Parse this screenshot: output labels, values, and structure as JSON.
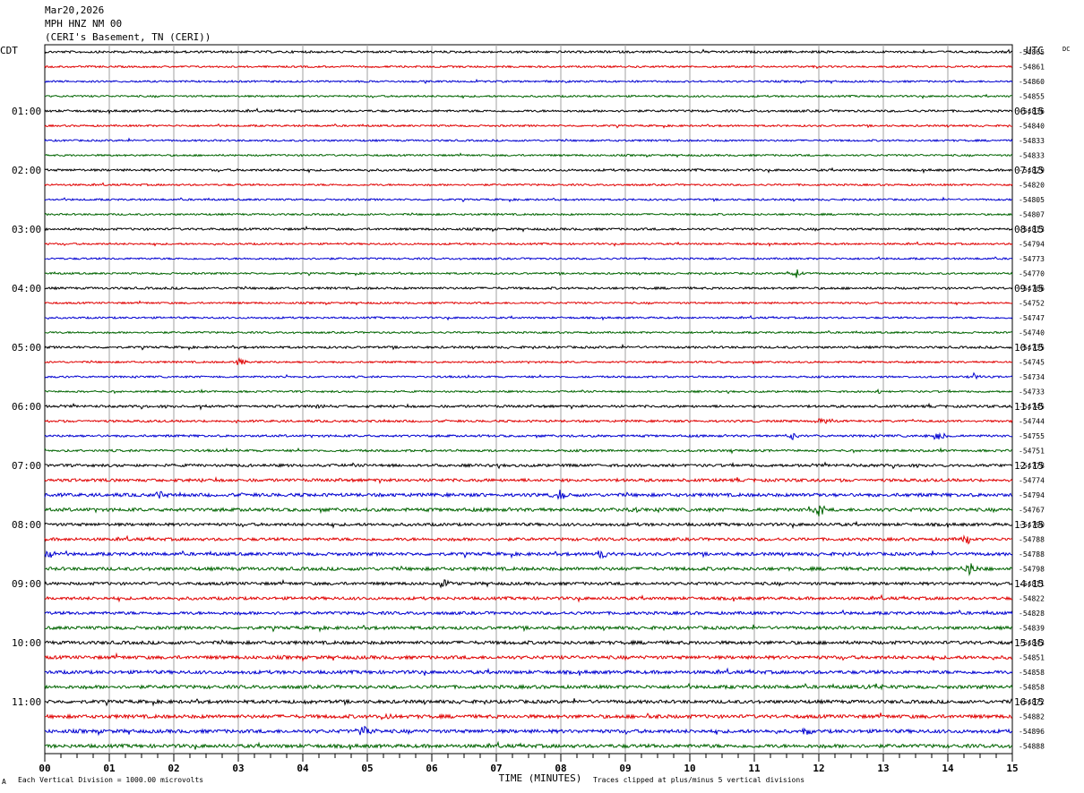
{
  "header": {
    "date": "Mar20,2026",
    "channel": "MPH HNZ NM 00",
    "station": "(CERI's Basement, TN (CERI))"
  },
  "left_timezone": "CDT",
  "right_timezone": "UTC",
  "dc_label": "DC",
  "footer": {
    "scale_note": "Each Vertical Division = 1000.00 microvolts",
    "xlabel": "TIME (MINUTES)",
    "clip_note": "Traces clipped at plus/minus 5 vertical divisions",
    "corner_mark": "A"
  },
  "colors": {
    "trace_cycle": [
      "#000000",
      "#e00000",
      "#0000d0",
      "#006400"
    ],
    "grid": "#a0a0a0"
  },
  "chart_data": {
    "type": "line",
    "title": "MPH HNZ NM 00",
    "xlabel": "TIME (MINUTES)",
    "xlim": [
      0,
      15
    ],
    "x_ticks": [
      "00",
      "01",
      "02",
      "03",
      "04",
      "05",
      "06",
      "07",
      "08",
      "09",
      "10",
      "11",
      "12",
      "13",
      "14",
      "15"
    ],
    "rows_per_hour": 4,
    "minutes_per_row": 15,
    "left_hour_labels": [
      "01:00",
      "02:00",
      "03:00",
      "04:00",
      "05:00",
      "06:00",
      "07:00",
      "08:00",
      "09:00",
      "10:00",
      "11:00"
    ],
    "right_hour_labels": [
      "06:15",
      "07:15",
      "08:15",
      "09:15",
      "10:15",
      "11:15",
      "12:15",
      "13:15",
      "14:15",
      "15:15",
      "16:15"
    ],
    "dc_offsets": [
      "-54865",
      "-54861",
      "-54860",
      "-54855",
      "-54836",
      "-54840",
      "-54833",
      "-54833",
      "-54829",
      "-54820",
      "-54805",
      "-54807",
      "-54813",
      "-54794",
      "-54773",
      "-54770",
      "-54766",
      "-54752",
      "-54747",
      "-54740",
      "-54735",
      "-54745",
      "-54734",
      "-54733",
      "-54745",
      "-54744",
      "-54755",
      "-54751",
      "-54778",
      "-54774",
      "-54794",
      "-54767",
      "-54790",
      "-54788",
      "-54788",
      "-54798",
      "-54811",
      "-54822",
      "-54828",
      "-54839",
      "-54843",
      "-54851",
      "-54858",
      "-54858",
      "-54872",
      "-54882",
      "-54896",
      "-54888"
    ],
    "trace_noise": [
      1.2,
      1.0,
      1.0,
      1.0,
      1.2,
      1.0,
      1.0,
      1.0,
      1.2,
      1.0,
      1.0,
      1.0,
      1.2,
      1.0,
      1.0,
      1.0,
      1.2,
      1.0,
      1.0,
      1.0,
      1.2,
      1.0,
      1.0,
      1.0,
      1.3,
      1.2,
      1.2,
      1.2,
      1.5,
      1.6,
      1.8,
      1.8,
      1.6,
      1.6,
      1.7,
      1.8,
      1.6,
      1.6,
      1.6,
      1.7,
      1.8,
      1.8,
      1.8,
      1.8,
      1.8,
      1.9,
      1.9,
      1.9
    ],
    "events": [
      {
        "row": 15,
        "minute": 11.65,
        "amplitude": 6
      },
      {
        "row": 21,
        "minute": 3.0,
        "amplitude": 7
      },
      {
        "row": 23,
        "minute": 12.9,
        "amplitude": 4
      },
      {
        "row": 22,
        "minute": 14.4,
        "amplitude": 4
      },
      {
        "row": 24,
        "minute": 2.4,
        "amplitude": 3
      },
      {
        "row": 24,
        "minute": 4.3,
        "amplitude": 3
      },
      {
        "row": 25,
        "minute": 12.05,
        "amplitude": 6
      },
      {
        "row": 26,
        "minute": 11.6,
        "amplitude": 5
      },
      {
        "row": 26,
        "minute": 13.85,
        "amplitude": 7
      },
      {
        "row": 30,
        "minute": 1.8,
        "amplitude": 4
      },
      {
        "row": 30,
        "minute": 8.0,
        "amplitude": 6
      },
      {
        "row": 30,
        "minute": 12.0,
        "amplitude": 4
      },
      {
        "row": 31,
        "minute": 9.15,
        "amplitude": 5
      },
      {
        "row": 31,
        "minute": 12.0,
        "amplitude": 10
      },
      {
        "row": 33,
        "minute": 14.3,
        "amplitude": 5
      },
      {
        "row": 34,
        "minute": 0.1,
        "amplitude": 7
      },
      {
        "row": 34,
        "minute": 8.65,
        "amplitude": 6
      },
      {
        "row": 35,
        "minute": 14.35,
        "amplitude": 6
      },
      {
        "row": 36,
        "minute": 6.2,
        "amplitude": 5
      },
      {
        "row": 43,
        "minute": 12.9,
        "amplitude": 5
      },
      {
        "row": 44,
        "minute": 4.1,
        "amplitude": 3
      },
      {
        "row": 45,
        "minute": 5.3,
        "amplitude": 5
      },
      {
        "row": 45,
        "minute": 9.4,
        "amplitude": 4
      },
      {
        "row": 46,
        "minute": 4.95,
        "amplitude": 9
      },
      {
        "row": 46,
        "minute": 11.8,
        "amplitude": 5
      }
    ]
  }
}
